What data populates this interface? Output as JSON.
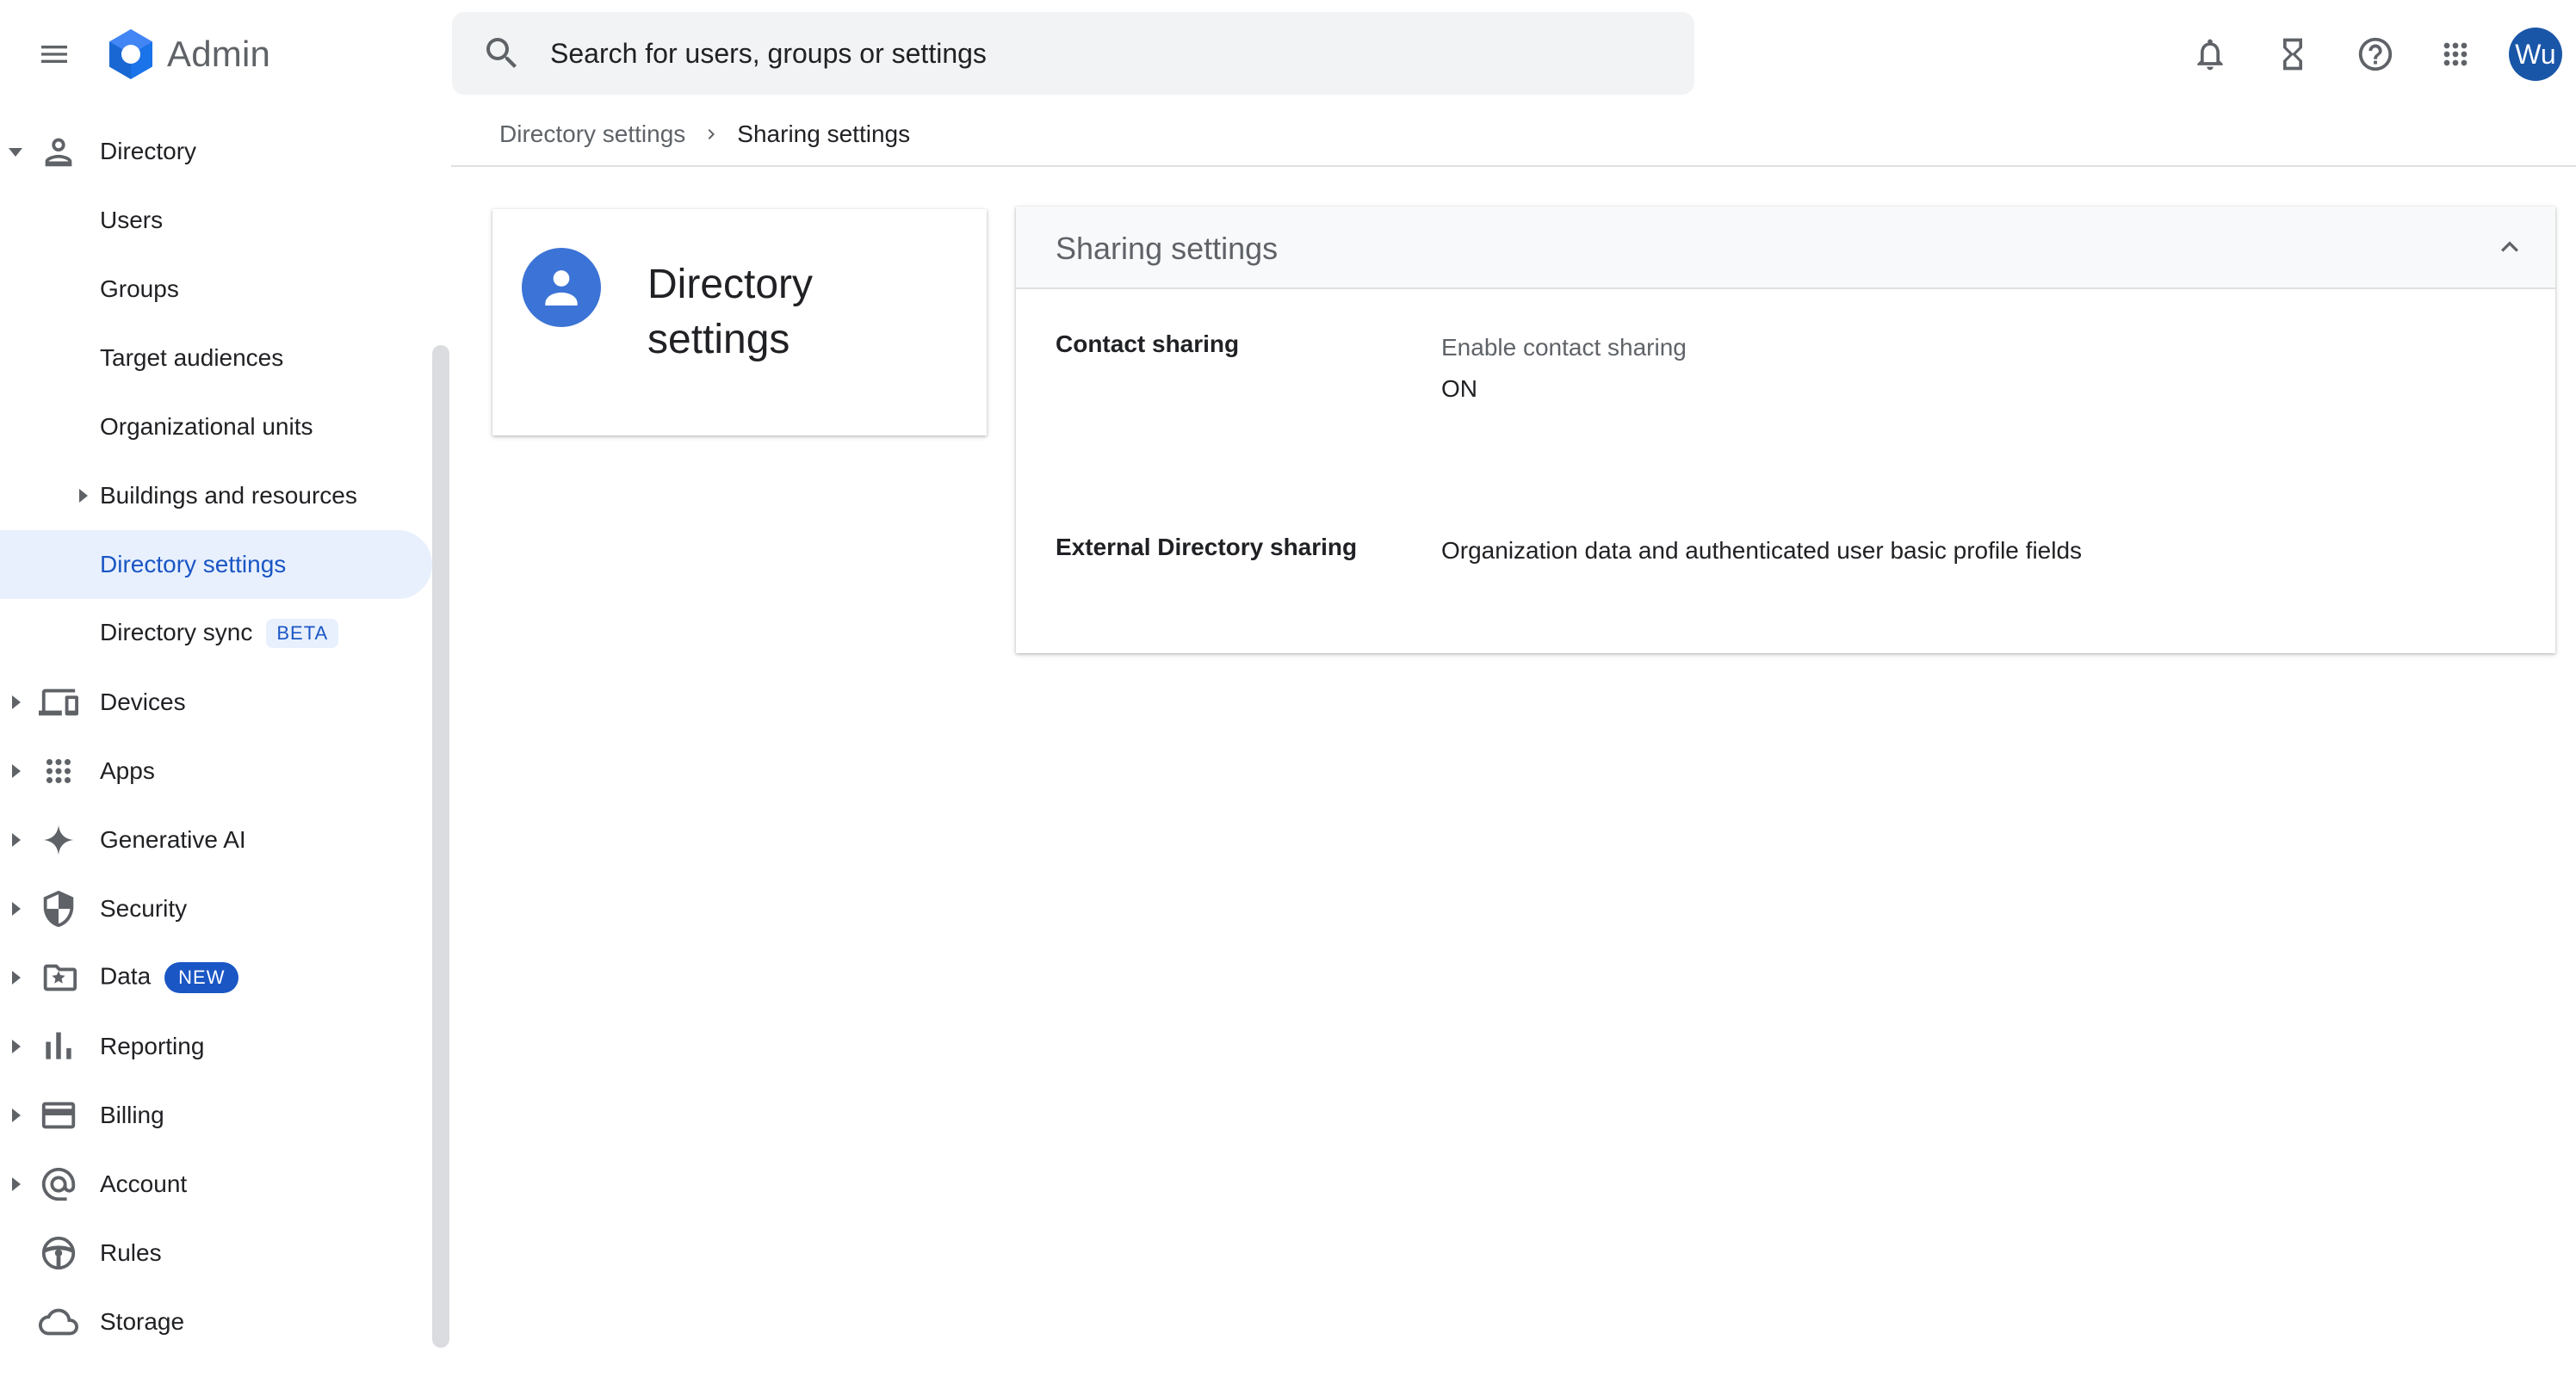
{
  "app": {
    "title": "Admin"
  },
  "search": {
    "placeholder": "Search for users, groups or settings"
  },
  "header_icons": [
    "notifications-icon",
    "tasks-hourglass-icon",
    "help-icon",
    "apps-grid-icon"
  ],
  "user": {
    "initials": "Wu",
    "avatar_color": "#1a56a8"
  },
  "sidebar": {
    "section": {
      "label": "Directory",
      "icon": "person-icon"
    },
    "sub_items": [
      {
        "label": "Users"
      },
      {
        "label": "Groups"
      },
      {
        "label": "Target audiences"
      },
      {
        "label": "Organizational units"
      },
      {
        "label": "Buildings and resources"
      },
      {
        "label": "Directory settings",
        "active": true
      },
      {
        "label": "Directory sync",
        "badge": "BETA"
      }
    ],
    "items": [
      {
        "label": "Devices",
        "icon": "devices-icon"
      },
      {
        "label": "Apps",
        "icon": "apps-icon"
      },
      {
        "label": "Generative AI",
        "icon": "sparkle-icon"
      },
      {
        "label": "Security",
        "icon": "shield-icon"
      },
      {
        "label": "Data",
        "icon": "folder-star-icon",
        "badge": "NEW"
      },
      {
        "label": "Reporting",
        "icon": "bar-chart-icon"
      },
      {
        "label": "Billing",
        "icon": "credit-card-icon"
      },
      {
        "label": "Account",
        "icon": "at-sign-icon"
      },
      {
        "label": "Rules",
        "icon": "steering-wheel-icon"
      },
      {
        "label": "Storage",
        "icon": "cloud-icon"
      }
    ]
  },
  "breadcrumb": {
    "parent": "Directory settings",
    "current": "Sharing settings"
  },
  "summary_card": {
    "title": "Directory settings",
    "icon": "person-icon",
    "icon_color": "#3b73d6"
  },
  "settings_card": {
    "title": "Sharing settings",
    "rows": [
      {
        "label": "Contact sharing",
        "sub": "Enable contact sharing",
        "value": "ON"
      },
      {
        "label": "External Directory sharing",
        "value": "Organization data and authenticated user basic profile fields"
      }
    ]
  },
  "colors": {
    "accent": "#1a56c4",
    "active_bg": "#e8f0fe"
  }
}
